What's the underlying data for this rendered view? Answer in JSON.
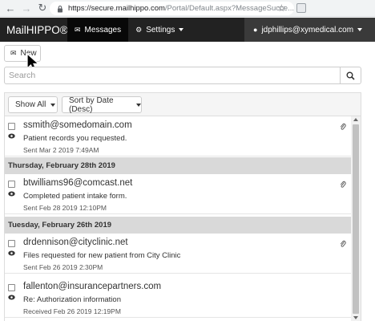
{
  "browser": {
    "url_main": "https://secure.mailhippo.com",
    "url_rest": "/Portal/Default.aspx?MessageSucce..."
  },
  "navbar": {
    "brand": "MailHIPPO®",
    "messages_label": "Messages",
    "settings_label": "Settings",
    "user_email": "jdphillips@xymedical.com"
  },
  "toolbar": {
    "new_label": "New",
    "search_placeholder": "Search"
  },
  "filters": {
    "show_all_label": "Show All",
    "sort_label": "Sort by Date (Desc)"
  },
  "messages": [
    {
      "from": "ssmith@somedomain.com",
      "subject": "Patient records you requested.",
      "meta": "Sent Mar 2 2019 7:49AM",
      "attachment": true
    },
    {
      "date_header": "Thursday, February 28th 2019",
      "from": "btwilliams96@comcast.net",
      "subject": "Completed patient intake form.",
      "meta": "Sent Feb 28 2019 12:10PM",
      "attachment": true
    },
    {
      "date_header": "Tuesday, February 26th 2019",
      "from": "drdennison@cityclinic.net",
      "subject": "Files requested for new patient from City Clinic",
      "meta": "Sent Feb 26 2019 2:30PM",
      "attachment": true
    },
    {
      "from": "fallenton@insurancepartners.com",
      "subject": "Re: Authorization information",
      "meta": "Received Feb 26 2019 12:19PM",
      "attachment": false
    }
  ],
  "colors": {
    "navbar_bg": "#222222",
    "navbar_active": "#080808",
    "date_header_bg": "#d9d9d9"
  }
}
